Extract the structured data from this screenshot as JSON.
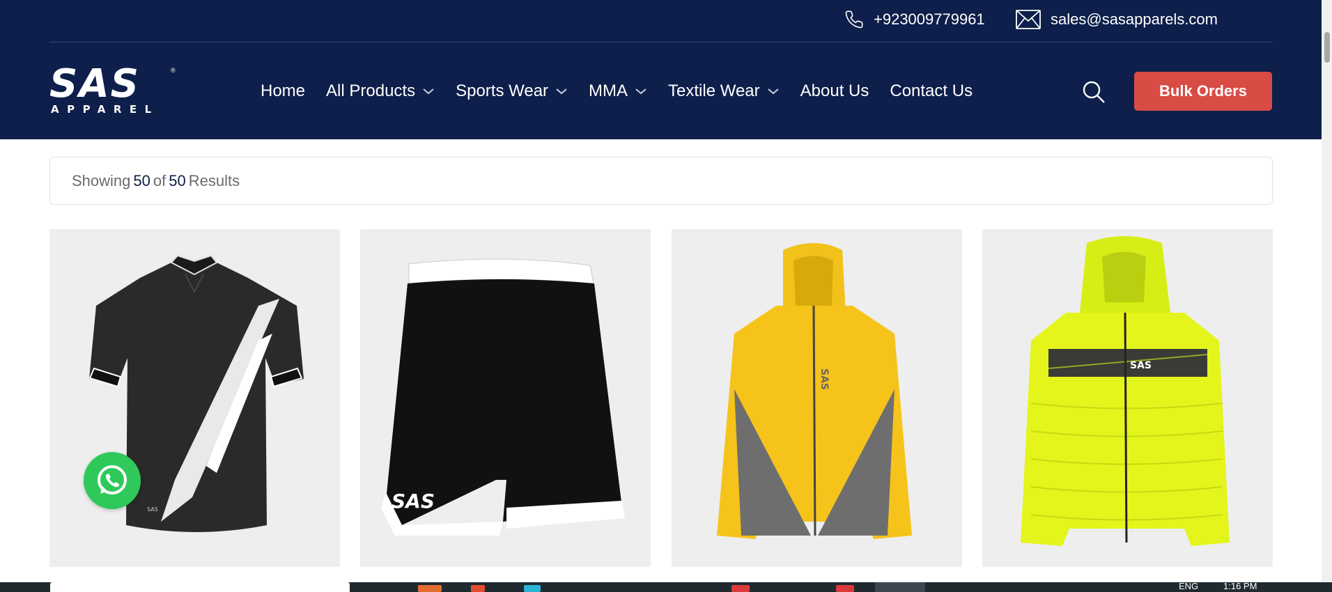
{
  "topbar": {
    "phone": "+923009779961",
    "email": "sales@sasapparels.com"
  },
  "logo": {
    "main": "SAS",
    "sub": "APPAREL"
  },
  "nav": {
    "items": [
      {
        "label": "Home",
        "dropdown": false
      },
      {
        "label": "All Products",
        "dropdown": true
      },
      {
        "label": "Sports Wear",
        "dropdown": true
      },
      {
        "label": "MMA",
        "dropdown": true
      },
      {
        "label": "Textile Wear",
        "dropdown": true
      },
      {
        "label": "About Us",
        "dropdown": false
      },
      {
        "label": "Contact Us",
        "dropdown": false
      }
    ]
  },
  "bulk_orders_label": "Bulk Orders",
  "results": {
    "prefix": "Showing",
    "shown": "50",
    "of": "of",
    "total": "50",
    "suffix": "Results"
  },
  "products": [
    {
      "name": "polo-shirt",
      "brand_print": "SAS"
    },
    {
      "name": "shorts",
      "brand_print": "SAS"
    },
    {
      "name": "yellow-hooded-jacket",
      "brand_print": "SAS"
    },
    {
      "name": "neon-puffer-jacket",
      "brand_print": "SAS"
    }
  ],
  "taskbar": {
    "lang": "ENG",
    "time": "1:16 PM"
  },
  "colors": {
    "header_bg": "#0d1f4a",
    "accent_button": "#d94b45",
    "whatsapp": "#2ec95a",
    "card_bg": "#eeeeee"
  },
  "icons": {
    "phone": "phone-icon",
    "mail": "mail-icon",
    "search": "search-icon",
    "chevron": "chevron-down-icon",
    "whatsapp": "whatsapp-icon"
  }
}
